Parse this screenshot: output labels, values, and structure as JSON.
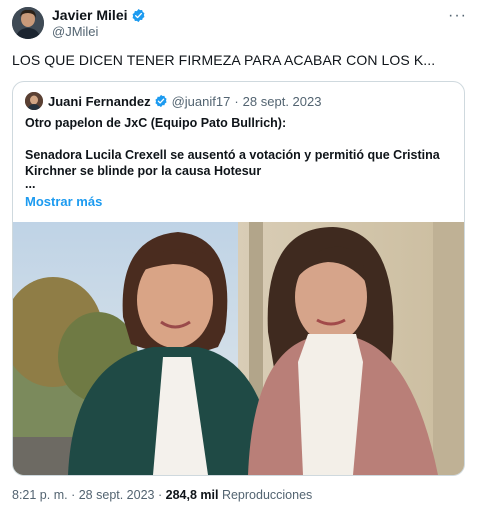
{
  "author": {
    "name": "Javier Milei",
    "handle": "@JMilei"
  },
  "tweet": {
    "text": "LOS QUE DICEN TENER FIRMEZA PARA ACABAR CON LOS K..."
  },
  "quoted": {
    "name": "Juani Fernandez",
    "handle": "@juanif17",
    "separator": "·",
    "date": "28 sept. 2023",
    "line1": "Otro papelon de JxC (Equipo Pato Bullrich):",
    "line2": "Senadora Lucila Crexell se ausentó a votación y permitió que Cristina Kirchner se blinde por la causa Hotesur",
    "ellipsis": "...",
    "show_more": "Mostrar más"
  },
  "footer": {
    "time": "8:21 p. m.",
    "separator": "·",
    "date": "28 sept. 2023",
    "views_separator": "·",
    "views": "284,8 mil",
    "views_label": "Reproducciones"
  },
  "colors": {
    "verified": "#1d9bf0",
    "link": "#1d9bf0",
    "muted": "#536471"
  }
}
